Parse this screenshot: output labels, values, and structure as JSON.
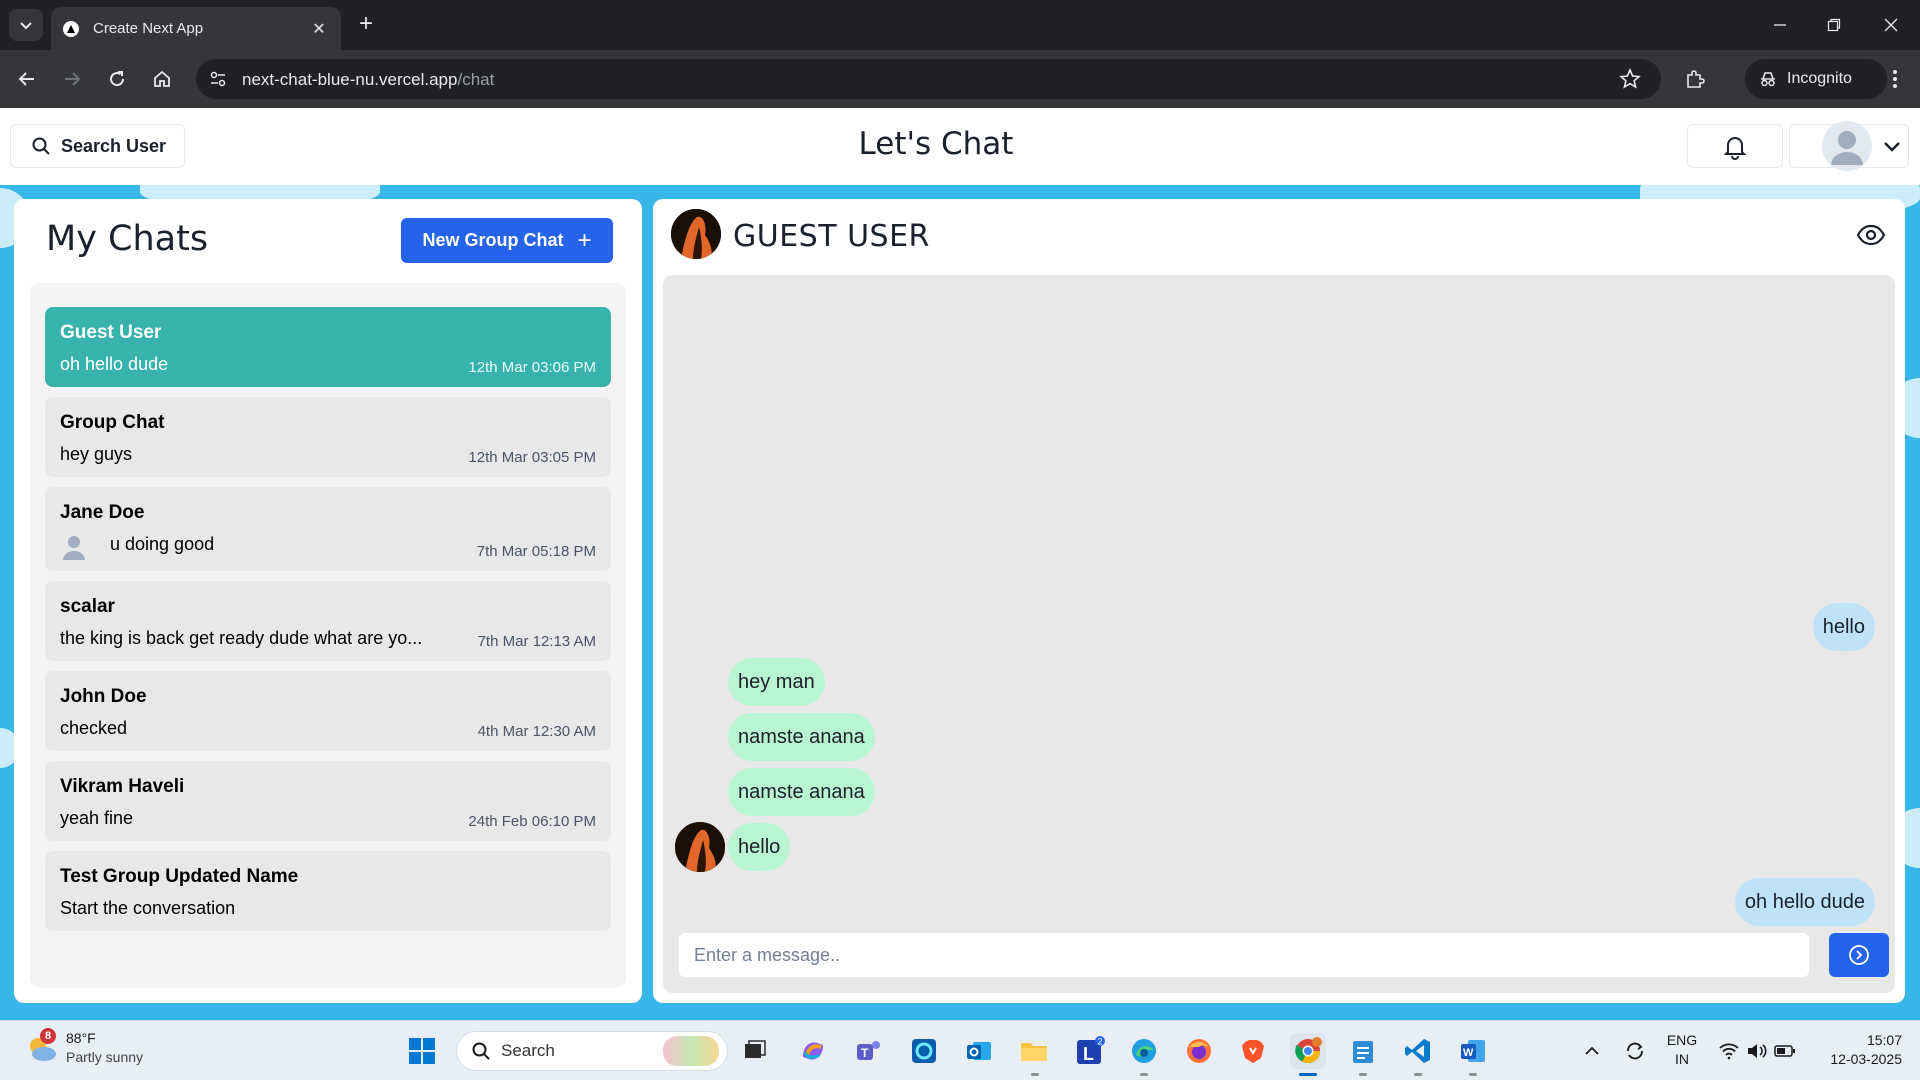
{
  "browser": {
    "tab_title": "Create Next App",
    "url_host": "next-chat-blue-nu.vercel.app",
    "url_path": "/chat",
    "incognito_label": "Incognito"
  },
  "header": {
    "search_label": "Search User",
    "app_title": "Let's Chat"
  },
  "sidebar": {
    "title": "My Chats",
    "new_group_label": "New Group Chat",
    "new_group_icon": "+",
    "chats": [
      {
        "name": "Guest User",
        "last": "oh hello dude",
        "time": "12th Mar 03:06 PM",
        "active": true
      },
      {
        "name": "Group Chat",
        "last": "hey guys",
        "time": "12th Mar 03:05 PM",
        "active": false
      },
      {
        "name": "Jane Doe",
        "last": "u doing good",
        "time": "7th Mar 05:18 PM",
        "active": false,
        "avatar": "user-icon"
      },
      {
        "name": "scalar",
        "last": "the king is back get ready dude what are yo...",
        "time": "7th Mar 12:13 AM",
        "active": false
      },
      {
        "name": "John Doe",
        "last": "checked",
        "time": "4th Mar 12:30 AM",
        "active": false
      },
      {
        "name": "Vikram Haveli",
        "last": "yeah fine",
        "time": "24th Feb 06:10 PM",
        "active": false
      },
      {
        "name": "Test Group Updated Name",
        "last": "Start the conversation",
        "time": "",
        "active": false
      }
    ]
  },
  "chat": {
    "title": "GUEST USER",
    "input_placeholder": "Enter a message..",
    "messages": [
      {
        "text": "hello",
        "from": "me"
      },
      {
        "text": "hey man",
        "from": "them"
      },
      {
        "text": "namste anana",
        "from": "them"
      },
      {
        "text": "namste anana",
        "from": "them"
      },
      {
        "text": "hello",
        "from": "them",
        "avatar": true
      },
      {
        "text": "oh hello dude",
        "from": "me"
      }
    ]
  },
  "taskbar": {
    "weather_badge": "8",
    "weather_temp": "88°F",
    "weather_desc": "Partly sunny",
    "search_label": "Search",
    "outlook_badge": "2",
    "lang_top": "ENG",
    "lang_bottom": "IN",
    "time": "15:07",
    "date": "12-03-2025"
  },
  "colors": {
    "accent": "#2563eb",
    "active_chat": "#38b2ac",
    "bubble_me": "#bee3f8",
    "bubble_them": "#b9f5d0",
    "background": "#38b6e8"
  }
}
